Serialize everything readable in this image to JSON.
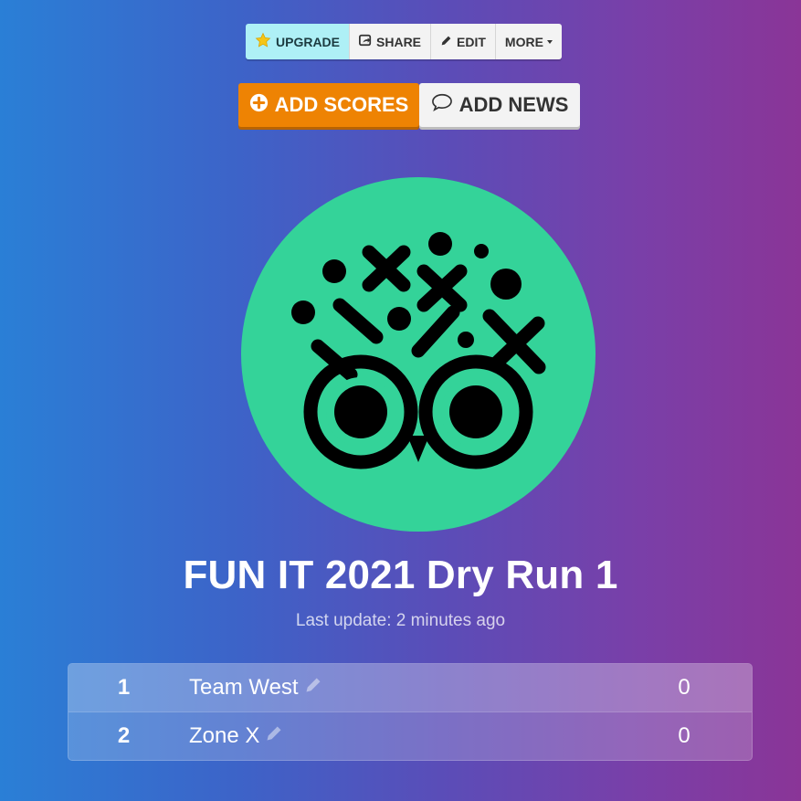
{
  "toolbar": {
    "upgrade_label": "UPGRADE",
    "share_label": "SHARE",
    "edit_label": "EDIT",
    "more_label": "MORE",
    "icons": [
      "star-icon",
      "share-icon",
      "pencil-icon",
      "caret-down-icon"
    ]
  },
  "actions": {
    "add_scores_label": "ADD SCORES",
    "add_news_label": "ADD NEWS",
    "icons": [
      "plus-circle-icon",
      "speech-bubble-icon"
    ]
  },
  "logo": {
    "icon": "owl-logo-icon",
    "bg_color": "#34d399"
  },
  "header": {
    "title": "FUN IT 2021 Dry Run 1",
    "last_update": "Last update: 2 minutes ago"
  },
  "scoreboard": {
    "rows": [
      {
        "rank": "1",
        "name": "Team West",
        "score": "0"
      },
      {
        "rank": "2",
        "name": "Zone X",
        "score": "0"
      }
    ]
  },
  "colors": {
    "accent_orange": "#ee8303",
    "upgrade_cyan": "#aef0f6",
    "gradient_left": "#2a7fd6",
    "gradient_right": "#8a3597"
  }
}
